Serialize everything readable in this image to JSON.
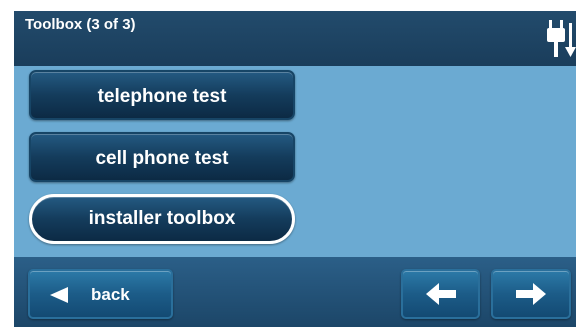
{
  "header": {
    "title": "Toolbox (3 of 3)",
    "status_icon": "power-plug-down-arrow-icon"
  },
  "menu": {
    "items": [
      {
        "label": "telephone test",
        "selected": false
      },
      {
        "label": "cell phone test",
        "selected": false
      },
      {
        "label": "installer toolbox",
        "selected": true
      }
    ]
  },
  "footer": {
    "back_label": "back",
    "back_icon": "triangle-left-icon",
    "prev_icon": "arrow-left-icon",
    "next_icon": "arrow-right-icon"
  },
  "colors": {
    "screen_bg": "#6baad2",
    "header_bg": "#1f4565",
    "button_dark": "#143c5c",
    "footer_button": "#1c5c88",
    "selected_outline": "#ffffff"
  }
}
